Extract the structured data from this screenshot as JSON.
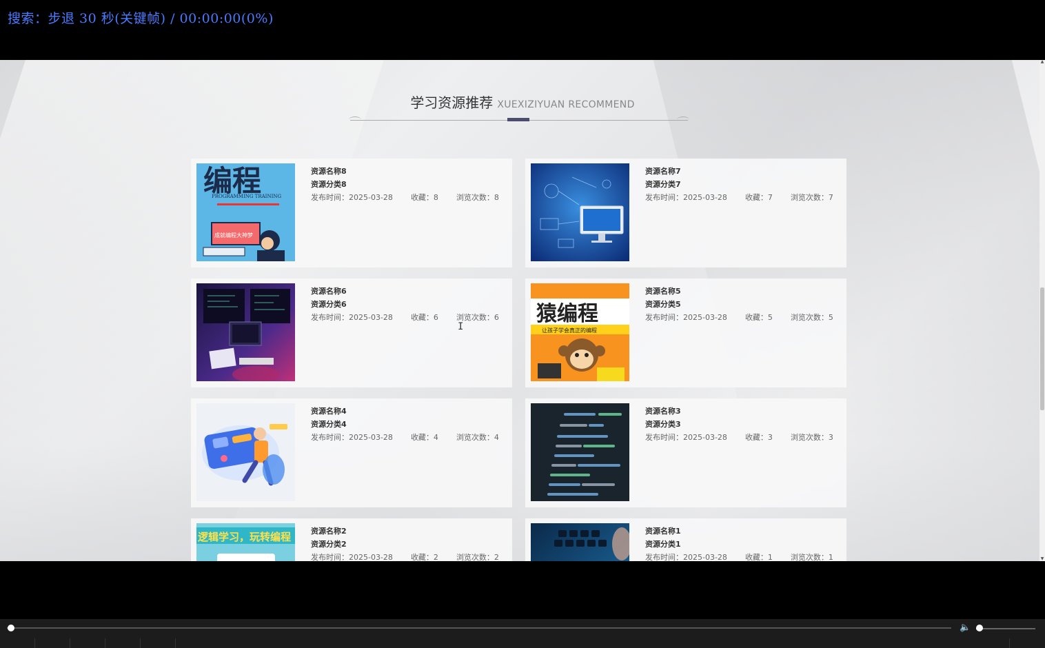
{
  "osd": {
    "text": "搜索：步退 30 秒(关键帧) / 00:00:00(0%)"
  },
  "section": {
    "title_cn": "学习资源推荐",
    "title_en": "XUEXIZIYUAN RECOMMEND"
  },
  "cards": [
    {
      "name": "资源名称8",
      "category": "资源分类8",
      "date_label": "发布时间：2025-03-28",
      "fav_label": "收藏：8",
      "views_label": "浏览次数：8"
    },
    {
      "name": "资源名称7",
      "category": "资源分类7",
      "date_label": "发布时间：2025-03-28",
      "fav_label": "收藏：7",
      "views_label": "浏览次数：7"
    },
    {
      "name": "资源名称6",
      "category": "资源分类6",
      "date_label": "发布时间：2025-03-28",
      "fav_label": "收藏：6",
      "views_label": "浏览次数：6"
    },
    {
      "name": "资源名称5",
      "category": "资源分类5",
      "date_label": "发布时间：2025-03-28",
      "fav_label": "收藏：5",
      "views_label": "浏览次数：5"
    },
    {
      "name": "资源名称4",
      "category": "资源分类4",
      "date_label": "发布时间：2025-03-28",
      "fav_label": "收藏：4",
      "views_label": "浏览次数：4"
    },
    {
      "name": "资源名称3",
      "category": "资源分类3",
      "date_label": "发布时间：2025-03-28",
      "fav_label": "收藏：3",
      "views_label": "浏览次数：3"
    },
    {
      "name": "资源名称2",
      "category": "资源分类2",
      "date_label": "发布时间：2025-03-28",
      "fav_label": "收藏：2",
      "views_label": "浏览次数：2"
    },
    {
      "name": "资源名称1",
      "category": "资源分类1",
      "date_label": "发布时间：2025-03-28",
      "fav_label": "收藏：1",
      "views_label": "浏览次数：1"
    }
  ],
  "thumb_text": {
    "t8_big": "编程",
    "t8_sub": "PROGRAMMING TRAINING",
    "t8_sign": "成就编程大神梦",
    "t5_big": "猿编程",
    "t5_sub": "让孩子学会真正的编程",
    "t2_band": "逻辑学习，玩转编程"
  },
  "player": {
    "seek_progress": 0,
    "volume_level": 0.05
  }
}
